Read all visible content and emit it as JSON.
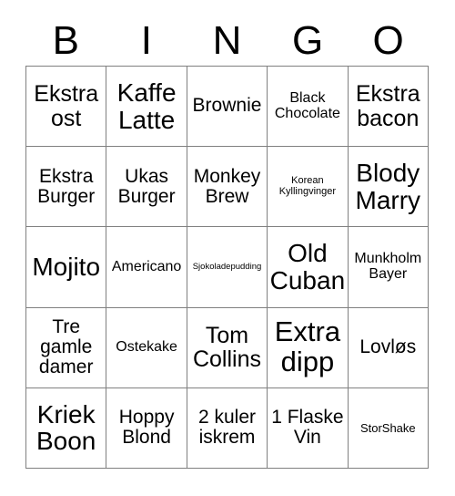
{
  "header": {
    "letters": [
      {
        "label": "B"
      },
      {
        "label": "I"
      },
      {
        "label": "N"
      },
      {
        "label": "G"
      },
      {
        "label": "O"
      }
    ]
  },
  "colors": {
    "background": "#ffffff",
    "text": "#000000",
    "gridline": "#808080"
  },
  "grid": {
    "columns": 5,
    "rows": 5,
    "cells": [
      {
        "text": "Ekstra ost",
        "size": "lg"
      },
      {
        "text": "Kaffe Latte",
        "size": "xl"
      },
      {
        "text": "Brownie",
        "size": "md"
      },
      {
        "text": "Black Chocolate",
        "size": "sm"
      },
      {
        "text": "Ekstra bacon",
        "size": "lg"
      },
      {
        "text": "Ekstra Burger",
        "size": "md"
      },
      {
        "text": "Ukas Burger",
        "size": "md"
      },
      {
        "text": "Monkey Brew",
        "size": "md"
      },
      {
        "text": "Korean Kyllingvinger",
        "size": "xxs"
      },
      {
        "text": "Blody Marry",
        "size": "xl"
      },
      {
        "text": "Mojito",
        "size": "xl"
      },
      {
        "text": "Americano",
        "size": "sm"
      },
      {
        "text": "Sjokoladepudding",
        "size": "tiny"
      },
      {
        "text": "Old Cuban",
        "size": "xl"
      },
      {
        "text": "Munkholm Bayer",
        "size": "sm"
      },
      {
        "text": "Tre gamle damer",
        "size": "md"
      },
      {
        "text": "Ostekake",
        "size": "sm"
      },
      {
        "text": "Tom Collins",
        "size": "lg"
      },
      {
        "text": "Extra dipp",
        "size": "xxl"
      },
      {
        "text": "Lovløs",
        "size": "md"
      },
      {
        "text": "Kriek Boon",
        "size": "xl"
      },
      {
        "text": "Hoppy Blond",
        "size": "md"
      },
      {
        "text": "2 kuler iskrem",
        "size": "md"
      },
      {
        "text": "1 Flaske Vin",
        "size": "md"
      },
      {
        "text": "StorShake",
        "size": "xs"
      }
    ]
  }
}
